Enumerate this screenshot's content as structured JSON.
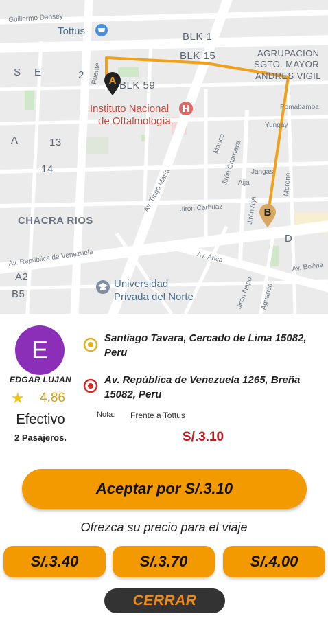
{
  "map": {
    "labels": {
      "street_guillermo": "Guillermo Dansey",
      "tottus": "Tottus",
      "blk1": "BLK 1",
      "blk15": "BLK 15",
      "agrupacion_1": "AGRUPACION",
      "agrupacion_2": "SGTO. MAYOR",
      "agrupacion_3": "ANDRES VIGIL",
      "s": "S",
      "e": "E",
      "two": "2",
      "blk59": "BLK 59",
      "puente": "Puente",
      "instituto_1": "Instituto Nacional",
      "instituto_2": "de Oftalmología",
      "pomabamba": "Pomabamba",
      "yungay": "Yungay",
      "a_district": "A",
      "thirteen": "13",
      "fourteen": "14",
      "manco": "Manco",
      "chamaya": "Jirón Chamaya",
      "tingo": "Av. Tingo María",
      "jangas": "Jangas",
      "aija": "Aija",
      "morona": "Morona",
      "jiron_carhuaz": "Jirón Carhuaz",
      "jiron_aija": "Jirón Aija",
      "chacra": "CHACRA RIOS",
      "d": "D",
      "venezuela": "Av. República de Venezuela",
      "arica": "Av. Arica",
      "bolivia": "Av. Bolivia",
      "a2": "A2",
      "b5": "B5",
      "universidad_1": "Universidad",
      "universidad_2": "Privada del Norte",
      "napo": "Jirón Napo",
      "aguarico": "Aguarico"
    },
    "markers": {
      "origin": "A",
      "destination": "B"
    },
    "route_color": "#f0a01a"
  },
  "driver": {
    "avatar_letter": "E",
    "name": "EDGAR LUJAN",
    "rating": "4.86",
    "payment_method": "Efectivo",
    "passengers": "2 Pasajeros."
  },
  "trip": {
    "origin": "Santiago Tavara, Cercado de Lima 15082, Peru",
    "destination": "Av. República de Venezuela 1265, Breña 15082, Peru",
    "note_label": "Nota:",
    "note_text": "Frente a Tottus",
    "price": "S/.3.10"
  },
  "actions": {
    "accept_label": "Aceptar por S/.3.10",
    "offer_title": "Ofrezca su precio para el viaje",
    "offers": [
      "S/.3.40",
      "S/.3.70",
      "S/.4.00"
    ],
    "close_label": "CERRAR"
  },
  "colors": {
    "accent": "#f39a00",
    "avatar": "#8b2fb8",
    "price": "#c0181d",
    "close_bg": "#333333",
    "close_text": "#f08a10"
  }
}
